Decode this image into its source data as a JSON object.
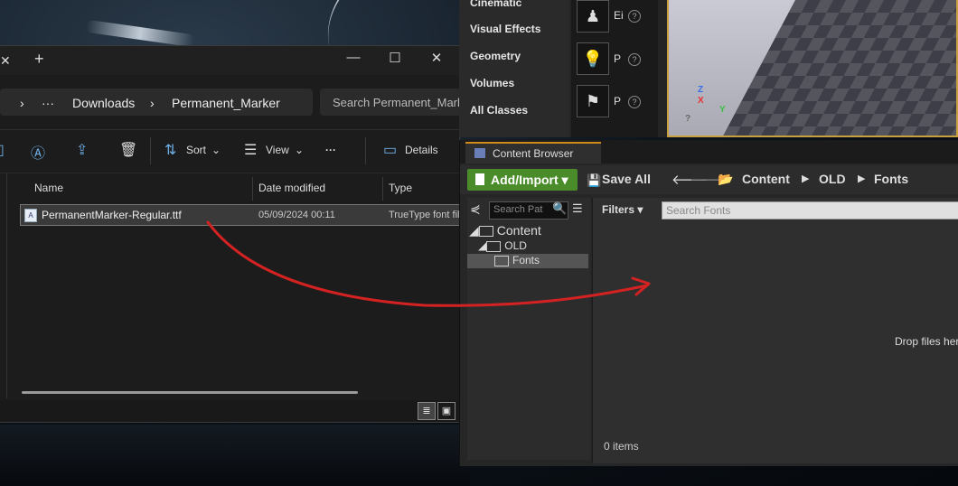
{
  "explorer": {
    "tab_close": "✕",
    "tab_plus": "+",
    "window_controls": {
      "minimize": "—",
      "maximize": "☐",
      "close": "✕"
    },
    "address": {
      "more": "···",
      "crumbs": [
        "Downloads",
        "Permanent_Marker"
      ],
      "separator": "›"
    },
    "search_placeholder": "Search Permanent_Marker",
    "toolbar": {
      "sort_label": "Sort",
      "view_label": "View",
      "more": "···",
      "details_label": "Details"
    },
    "columns": [
      "Name",
      "Date modified",
      "Type"
    ],
    "files": [
      {
        "name": "PermanentMarker-Regular.ttf",
        "date": "05/09/2024 00:11",
        "type": "TrueType font file"
      }
    ]
  },
  "unreal": {
    "place_categories": [
      "Cinematic",
      "Visual Effects",
      "Geometry",
      "Volumes",
      "All Classes"
    ],
    "place_items": [
      {
        "icon": "♟",
        "label": "Ei"
      },
      {
        "icon": "💡",
        "label": "P"
      },
      {
        "icon": "⚑",
        "label": "P"
      }
    ],
    "viewport_axes": {
      "z": "Z",
      "x": "X",
      "y": "Y"
    },
    "content_browser": {
      "tab_label": "Content Browser",
      "add_import_label": "Add/Import ▾",
      "save_all_label": "Save All",
      "breadcrumbs": [
        "Content",
        "OLD",
        "Fonts"
      ],
      "path_search_placeholder": "Search Pat",
      "tree": [
        "Content",
        "OLD",
        "Fonts"
      ],
      "filters_label": "Filters ▾",
      "asset_search_placeholder": "Search Fonts",
      "drop_text": "Drop files here",
      "items_count": "0 items"
    }
  },
  "colors": {
    "arrow": "#d42222",
    "add_import_green": "#4b8c2a",
    "tab_accent": "#d08a1a",
    "viewport_border": "#c8a040"
  }
}
